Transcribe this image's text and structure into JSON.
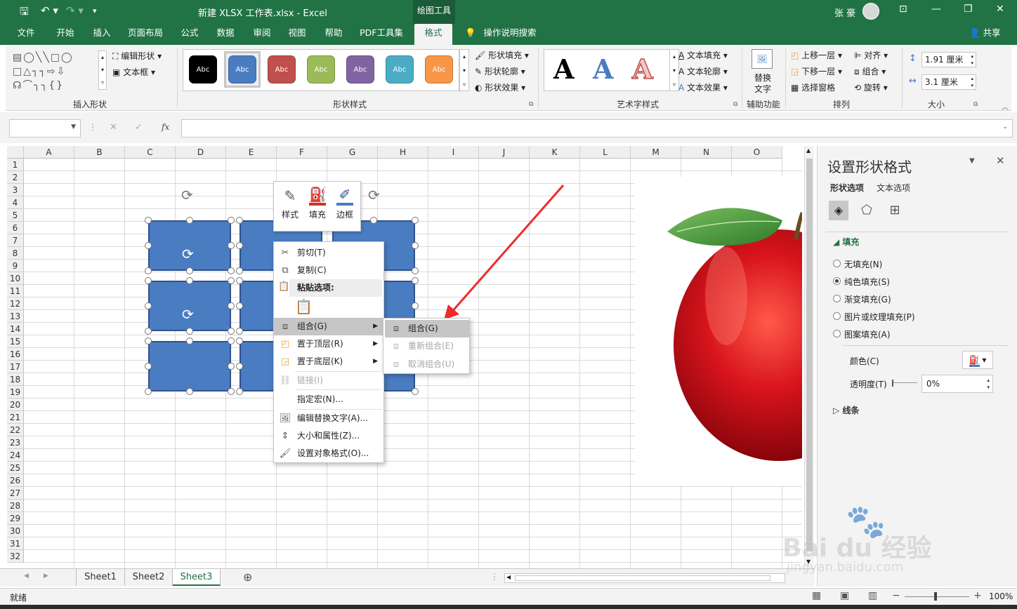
{
  "titlebar": {
    "file_title": "新建 XLSX 工作表.xlsx  -  Excel",
    "context_tab": "绘图工具",
    "user": "张 豪"
  },
  "tabs": [
    "文件",
    "开始",
    "插入",
    "页面布局",
    "公式",
    "数据",
    "审阅",
    "视图",
    "帮助",
    "PDF工具集",
    "格式"
  ],
  "active_tab": "格式",
  "tell_me": "操作说明搜索",
  "share": "共享",
  "ribbon": {
    "insert_shapes": {
      "label": "插入形状",
      "edit_shape": "编辑形状",
      "textbox": "文本框"
    },
    "shape_styles": {
      "label": "形状样式",
      "swatches": [
        "Abc",
        "Abc",
        "Abc",
        "Abc",
        "Abc",
        "Abc",
        "Abc"
      ],
      "colors": [
        "#000000",
        "#4a7cc1",
        "#c0504d",
        "#9bbb59",
        "#8064a2",
        "#4bacc6",
        "#f79646"
      ],
      "fill": "形状填充",
      "outline": "形状轮廓",
      "effects": "形状效果"
    },
    "wordart": {
      "label": "艺术字样式",
      "letters": [
        "A",
        "A",
        "A"
      ],
      "text_fill": "文本填充",
      "text_outline": "文本轮廓",
      "text_effects": "文本效果"
    },
    "accessibility": {
      "label": "辅助功能",
      "alt_text_1": "替换",
      "alt_text_2": "文字"
    },
    "arrange": {
      "label": "排列",
      "bring_forward": "上移一层",
      "send_backward": "下移一层",
      "selection_pane": "选择窗格",
      "align": "对齐",
      "group": "组合",
      "rotate": "旋转"
    },
    "size": {
      "label": "大小",
      "height": "1.91 厘米",
      "width": "3.1 厘米"
    }
  },
  "formula_bar": {
    "fx": "fx"
  },
  "columns": [
    "A",
    "B",
    "C",
    "D",
    "E",
    "F",
    "G",
    "H",
    "I",
    "J",
    "K",
    "L",
    "M",
    "N",
    "O"
  ],
  "rows": [
    "1",
    "2",
    "3",
    "4",
    "5",
    "6",
    "7",
    "8",
    "9",
    "10",
    "11",
    "12",
    "13",
    "14",
    "15",
    "16",
    "17",
    "18",
    "19",
    "20",
    "21",
    "22",
    "23",
    "24",
    "25",
    "26",
    "27",
    "28",
    "29",
    "30",
    "31",
    "32"
  ],
  "mini_toolbar": {
    "style": "样式",
    "fill": "填充",
    "border": "边框"
  },
  "context_menu": {
    "cut": "剪切(T)",
    "copy": "复制(C)",
    "paste_options": "粘贴选项:",
    "group": "组合(G)",
    "bring_to_front": "置于顶层(R)",
    "send_to_back": "置于底层(K)",
    "link": "链接(I)",
    "assign_macro": "指定宏(N)...",
    "edit_alt_text": "编辑替换文字(A)...",
    "size_properties": "大小和属性(Z)...",
    "format_object": "设置对象格式(O)..."
  },
  "submenu": {
    "group": "组合(G)",
    "regroup": "重新组合(E)",
    "ungroup": "取消组合(U)"
  },
  "panel": {
    "title": "设置形状格式",
    "tab_shape": "形状选项",
    "tab_text": "文本选项",
    "fill_section": "填充",
    "options": [
      "无填充(N)",
      "纯色填充(S)",
      "渐变填充(G)",
      "图片或纹理填充(P)",
      "图案填充(A)"
    ],
    "selected_option": 1,
    "color_label": "颜色(C)",
    "transparency_label": "透明度(T)",
    "transparency_value": "0%",
    "line_section": "线条"
  },
  "sheet_tabs": [
    "Sheet1",
    "Sheet2",
    "Sheet3"
  ],
  "active_sheet": "Sheet3",
  "status": {
    "ready": "就绪",
    "zoom": "100%"
  },
  "watermark": {
    "brand": "Bai du 经验",
    "url": "jingyan.baidu.com"
  }
}
